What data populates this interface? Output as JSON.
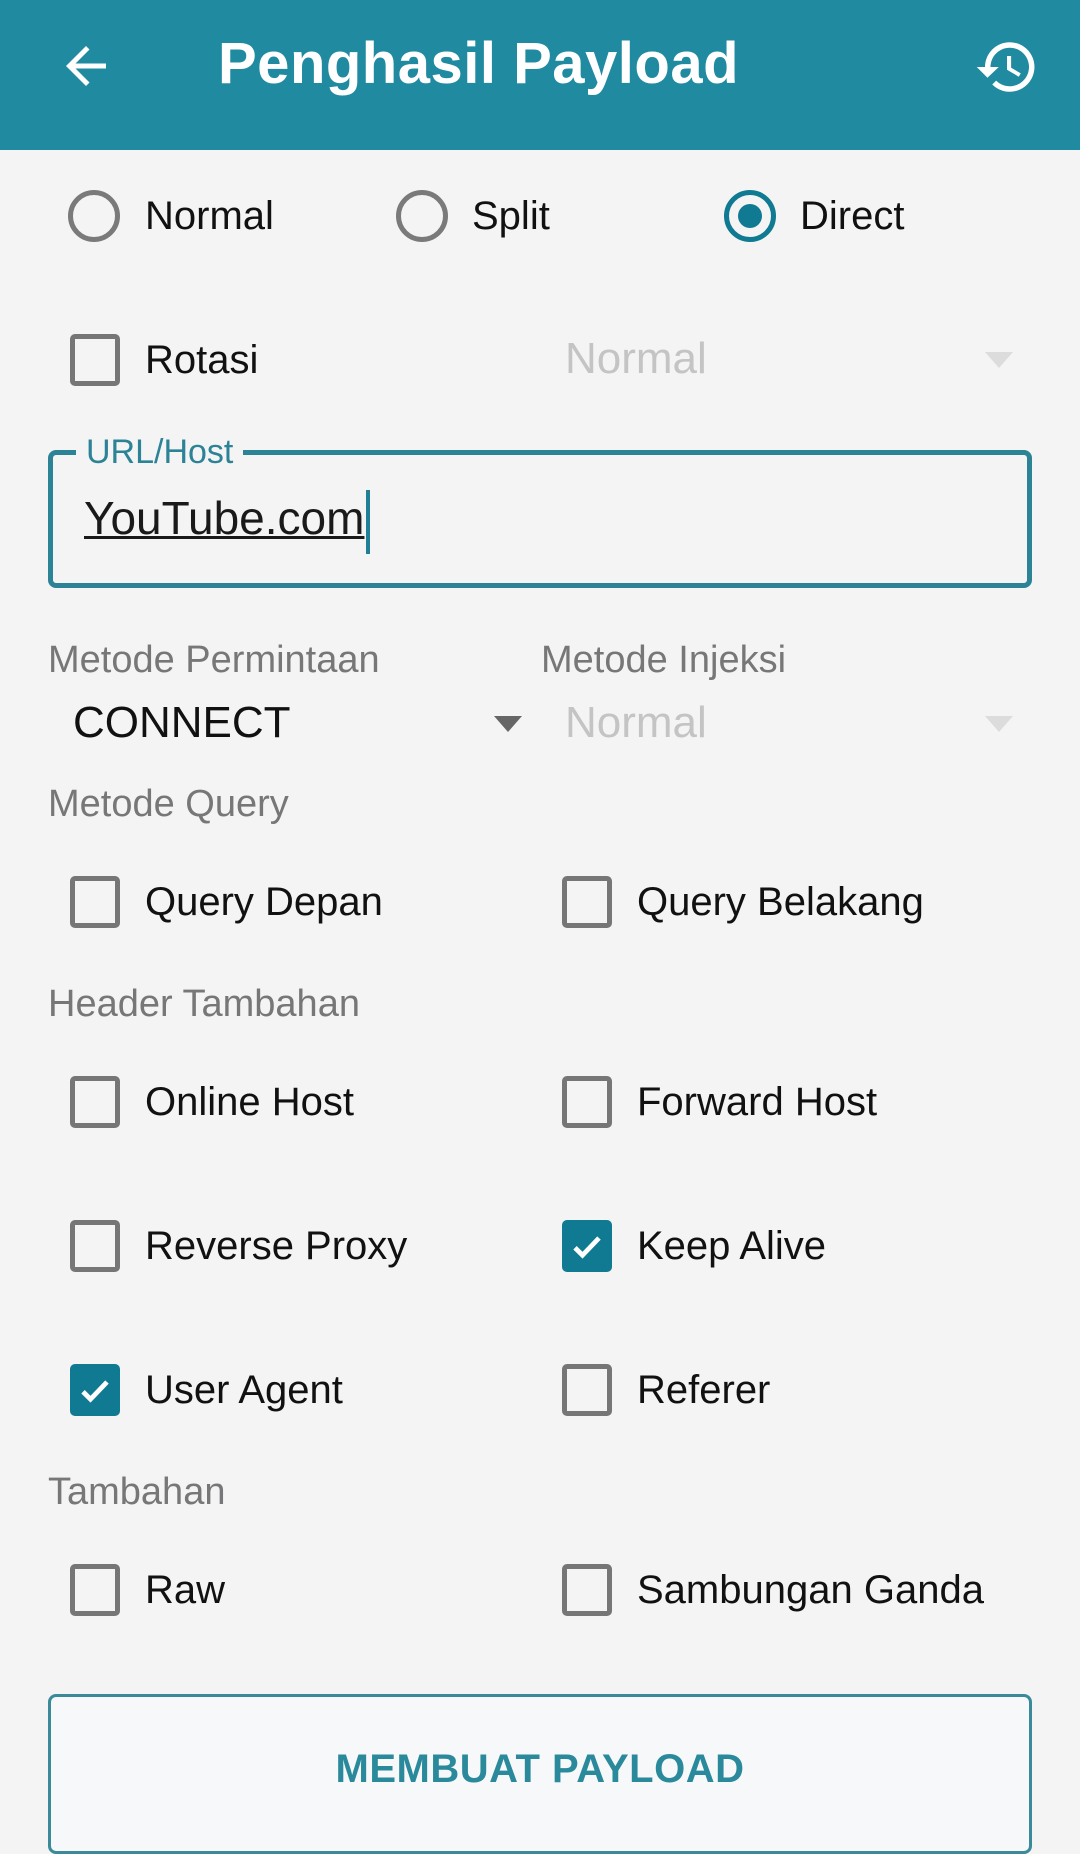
{
  "appbar": {
    "title": "Penghasil Payload",
    "back_icon": "arrow-left-icon",
    "history_icon": "history-icon",
    "color": "#1f8aa0"
  },
  "mode": {
    "options": [
      {
        "label": "Normal",
        "selected": false
      },
      {
        "label": "Split",
        "selected": false
      },
      {
        "label": "Direct",
        "selected": true
      }
    ]
  },
  "rotation": {
    "label": "Rotasi",
    "checked": false,
    "dropdown_value": "Normal",
    "dropdown_enabled": false
  },
  "url_host": {
    "label": "URL/Host",
    "value": "YouTube.com"
  },
  "request_method": {
    "label": "Metode Permintaan",
    "value": "CONNECT"
  },
  "injection_method": {
    "label": "Metode Injeksi",
    "value": "Normal",
    "enabled": false
  },
  "query_method": {
    "label": "Metode Query",
    "options": [
      {
        "label": "Query Depan",
        "checked": false
      },
      {
        "label": "Query Belakang",
        "checked": false
      }
    ]
  },
  "extra_headers": {
    "label": "Header Tambahan",
    "options": [
      {
        "label": "Online Host",
        "checked": false
      },
      {
        "label": "Forward Host",
        "checked": false
      },
      {
        "label": "Reverse Proxy",
        "checked": false
      },
      {
        "label": "Keep Alive",
        "checked": true
      },
      {
        "label": "User Agent",
        "checked": true
      },
      {
        "label": "Referer",
        "checked": false
      }
    ]
  },
  "extras": {
    "label": "Tambahan",
    "options": [
      {
        "label": "Raw",
        "checked": false
      },
      {
        "label": "Sambungan Ganda",
        "checked": false
      }
    ]
  },
  "generate_button": {
    "label": "MEMBUAT PAYLOAD"
  },
  "accent_color": "#0f7a92"
}
